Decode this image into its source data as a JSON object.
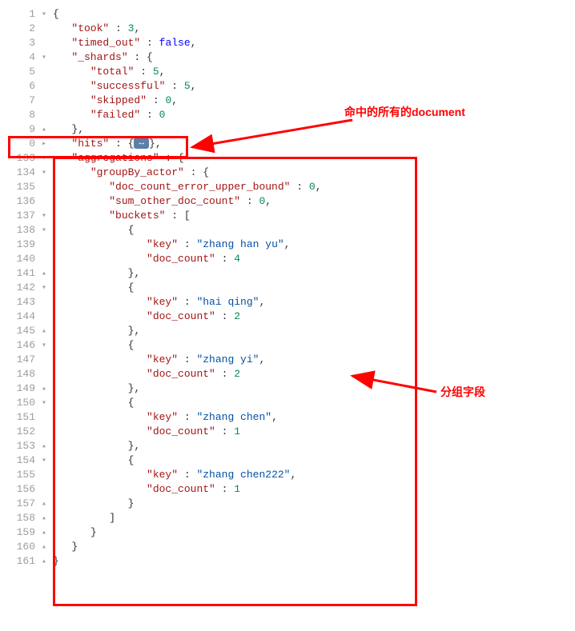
{
  "annotations": {
    "hits_label": "命中的所有的document",
    "group_label": "分组字段"
  },
  "collapsed_badge": "↔",
  "lines": [
    {
      "n": "1",
      "fold": "▾",
      "indent": 0,
      "tokens": [
        {
          "t": "{",
          "c": "pc"
        }
      ]
    },
    {
      "n": "2",
      "fold": "",
      "indent": 1,
      "tokens": [
        {
          "t": "\"took\"",
          "c": "q"
        },
        {
          "t": " : ",
          "c": "pc"
        },
        {
          "t": "3",
          "c": "nv"
        },
        {
          "t": ",",
          "c": "pc"
        }
      ]
    },
    {
      "n": "3",
      "fold": "",
      "indent": 1,
      "tokens": [
        {
          "t": "\"timed_out\"",
          "c": "q"
        },
        {
          "t": " : ",
          "c": "pc"
        },
        {
          "t": "false",
          "c": "bv"
        },
        {
          "t": ",",
          "c": "pc"
        }
      ]
    },
    {
      "n": "4",
      "fold": "▾",
      "indent": 1,
      "tokens": [
        {
          "t": "\"_shards\"",
          "c": "q"
        },
        {
          "t": " : {",
          "c": "pc"
        }
      ]
    },
    {
      "n": "5",
      "fold": "",
      "indent": 2,
      "tokens": [
        {
          "t": "\"total\"",
          "c": "q"
        },
        {
          "t": " : ",
          "c": "pc"
        },
        {
          "t": "5",
          "c": "nv"
        },
        {
          "t": ",",
          "c": "pc"
        }
      ]
    },
    {
      "n": "6",
      "fold": "",
      "indent": 2,
      "tokens": [
        {
          "t": "\"successful\"",
          "c": "q"
        },
        {
          "t": " : ",
          "c": "pc"
        },
        {
          "t": "5",
          "c": "nv"
        },
        {
          "t": ",",
          "c": "pc"
        }
      ]
    },
    {
      "n": "7",
      "fold": "",
      "indent": 2,
      "tokens": [
        {
          "t": "\"skipped\"",
          "c": "q"
        },
        {
          "t": " : ",
          "c": "pc"
        },
        {
          "t": "0",
          "c": "nv"
        },
        {
          "t": ",",
          "c": "pc"
        }
      ]
    },
    {
      "n": "8",
      "fold": "",
      "indent": 2,
      "tokens": [
        {
          "t": "\"failed\"",
          "c": "q"
        },
        {
          "t": " : ",
          "c": "pc"
        },
        {
          "t": "0",
          "c": "nv"
        }
      ]
    },
    {
      "n": "9",
      "fold": "▴",
      "indent": 1,
      "tokens": [
        {
          "t": "},",
          "c": "pc"
        }
      ]
    },
    {
      "n": "0",
      "fold": "▸",
      "indent": 1,
      "tokens": [
        {
          "t": "\"hits\"",
          "c": "q"
        },
        {
          "t": " : {",
          "c": "pc"
        },
        {
          "badge": true
        },
        {
          "t": "},",
          "c": "pc"
        }
      ]
    },
    {
      "n": "133",
      "fold": "▾",
      "indent": 1,
      "tokens": [
        {
          "t": "\"aggregations\"",
          "c": "q"
        },
        {
          "t": " : {",
          "c": "pc"
        }
      ]
    },
    {
      "n": "134",
      "fold": "▾",
      "indent": 2,
      "tokens": [
        {
          "t": "\"groupBy_actor\"",
          "c": "q"
        },
        {
          "t": " : {",
          "c": "pc"
        }
      ]
    },
    {
      "n": "135",
      "fold": "",
      "indent": 3,
      "tokens": [
        {
          "t": "\"doc_count_error_upper_bound\"",
          "c": "q"
        },
        {
          "t": " : ",
          "c": "pc"
        },
        {
          "t": "0",
          "c": "nv"
        },
        {
          "t": ",",
          "c": "pc"
        }
      ]
    },
    {
      "n": "136",
      "fold": "",
      "indent": 3,
      "tokens": [
        {
          "t": "\"sum_other_doc_count\"",
          "c": "q"
        },
        {
          "t": " : ",
          "c": "pc"
        },
        {
          "t": "0",
          "c": "nv"
        },
        {
          "t": ",",
          "c": "pc"
        }
      ]
    },
    {
      "n": "137",
      "fold": "▾",
      "indent": 3,
      "tokens": [
        {
          "t": "\"buckets\"",
          "c": "q"
        },
        {
          "t": " : [",
          "c": "pc"
        }
      ]
    },
    {
      "n": "138",
      "fold": "▾",
      "indent": 4,
      "tokens": [
        {
          "t": "{",
          "c": "pc"
        }
      ]
    },
    {
      "n": "139",
      "fold": "",
      "indent": 5,
      "tokens": [
        {
          "t": "\"key\"",
          "c": "q"
        },
        {
          "t": " : ",
          "c": "pc"
        },
        {
          "t": "\"zhang han yu\"",
          "c": "sv"
        },
        {
          "t": ",",
          "c": "pc"
        }
      ]
    },
    {
      "n": "140",
      "fold": "",
      "indent": 5,
      "tokens": [
        {
          "t": "\"doc_count\"",
          "c": "q"
        },
        {
          "t": " : ",
          "c": "pc"
        },
        {
          "t": "4",
          "c": "nv"
        }
      ]
    },
    {
      "n": "141",
      "fold": "▴",
      "indent": 4,
      "tokens": [
        {
          "t": "},",
          "c": "pc"
        }
      ]
    },
    {
      "n": "142",
      "fold": "▾",
      "indent": 4,
      "tokens": [
        {
          "t": "{",
          "c": "pc"
        }
      ]
    },
    {
      "n": "143",
      "fold": "",
      "indent": 5,
      "tokens": [
        {
          "t": "\"key\"",
          "c": "q"
        },
        {
          "t": " : ",
          "c": "pc"
        },
        {
          "t": "\"hai qing\"",
          "c": "sv"
        },
        {
          "t": ",",
          "c": "pc"
        }
      ]
    },
    {
      "n": "144",
      "fold": "",
      "indent": 5,
      "tokens": [
        {
          "t": "\"doc_count\"",
          "c": "q"
        },
        {
          "t": " : ",
          "c": "pc"
        },
        {
          "t": "2",
          "c": "nv"
        }
      ]
    },
    {
      "n": "145",
      "fold": "▴",
      "indent": 4,
      "tokens": [
        {
          "t": "},",
          "c": "pc"
        }
      ]
    },
    {
      "n": "146",
      "fold": "▾",
      "indent": 4,
      "tokens": [
        {
          "t": "{",
          "c": "pc"
        }
      ]
    },
    {
      "n": "147",
      "fold": "",
      "indent": 5,
      "tokens": [
        {
          "t": "\"key\"",
          "c": "q"
        },
        {
          "t": " : ",
          "c": "pc"
        },
        {
          "t": "\"zhang yi\"",
          "c": "sv"
        },
        {
          "t": ",",
          "c": "pc"
        }
      ]
    },
    {
      "n": "148",
      "fold": "",
      "indent": 5,
      "tokens": [
        {
          "t": "\"doc_count\"",
          "c": "q"
        },
        {
          "t": " : ",
          "c": "pc"
        },
        {
          "t": "2",
          "c": "nv"
        }
      ]
    },
    {
      "n": "149",
      "fold": "▴",
      "indent": 4,
      "tokens": [
        {
          "t": "},",
          "c": "pc"
        }
      ]
    },
    {
      "n": "150",
      "fold": "▾",
      "indent": 4,
      "tokens": [
        {
          "t": "{",
          "c": "pc"
        }
      ]
    },
    {
      "n": "151",
      "fold": "",
      "indent": 5,
      "tokens": [
        {
          "t": "\"key\"",
          "c": "q"
        },
        {
          "t": " : ",
          "c": "pc"
        },
        {
          "t": "\"zhang chen\"",
          "c": "sv"
        },
        {
          "t": ",",
          "c": "pc"
        }
      ]
    },
    {
      "n": "152",
      "fold": "",
      "indent": 5,
      "tokens": [
        {
          "t": "\"doc_count\"",
          "c": "q"
        },
        {
          "t": " : ",
          "c": "pc"
        },
        {
          "t": "1",
          "c": "nv"
        }
      ]
    },
    {
      "n": "153",
      "fold": "▴",
      "indent": 4,
      "tokens": [
        {
          "t": "},",
          "c": "pc"
        }
      ]
    },
    {
      "n": "154",
      "fold": "▾",
      "indent": 4,
      "tokens": [
        {
          "t": "{",
          "c": "pc"
        }
      ]
    },
    {
      "n": "155",
      "fold": "",
      "indent": 5,
      "tokens": [
        {
          "t": "\"key\"",
          "c": "q"
        },
        {
          "t": " : ",
          "c": "pc"
        },
        {
          "t": "\"zhang chen222\"",
          "c": "sv"
        },
        {
          "t": ",",
          "c": "pc"
        }
      ]
    },
    {
      "n": "156",
      "fold": "",
      "indent": 5,
      "tokens": [
        {
          "t": "\"doc_count\"",
          "c": "q"
        },
        {
          "t": " : ",
          "c": "pc"
        },
        {
          "t": "1",
          "c": "nv"
        }
      ]
    },
    {
      "n": "157",
      "fold": "▴",
      "indent": 4,
      "tokens": [
        {
          "t": "}",
          "c": "pc"
        }
      ]
    },
    {
      "n": "158",
      "fold": "▴",
      "indent": 3,
      "tokens": [
        {
          "t": "]",
          "c": "pc"
        }
      ]
    },
    {
      "n": "159",
      "fold": "▴",
      "indent": 2,
      "tokens": [
        {
          "t": "}",
          "c": "pc"
        }
      ]
    },
    {
      "n": "160",
      "fold": "▴",
      "indent": 1,
      "tokens": [
        {
          "t": "}",
          "c": "pc"
        }
      ]
    },
    {
      "n": "161",
      "fold": "▴",
      "indent": 0,
      "tokens": [
        {
          "t": "}",
          "c": "pc"
        }
      ]
    }
  ]
}
